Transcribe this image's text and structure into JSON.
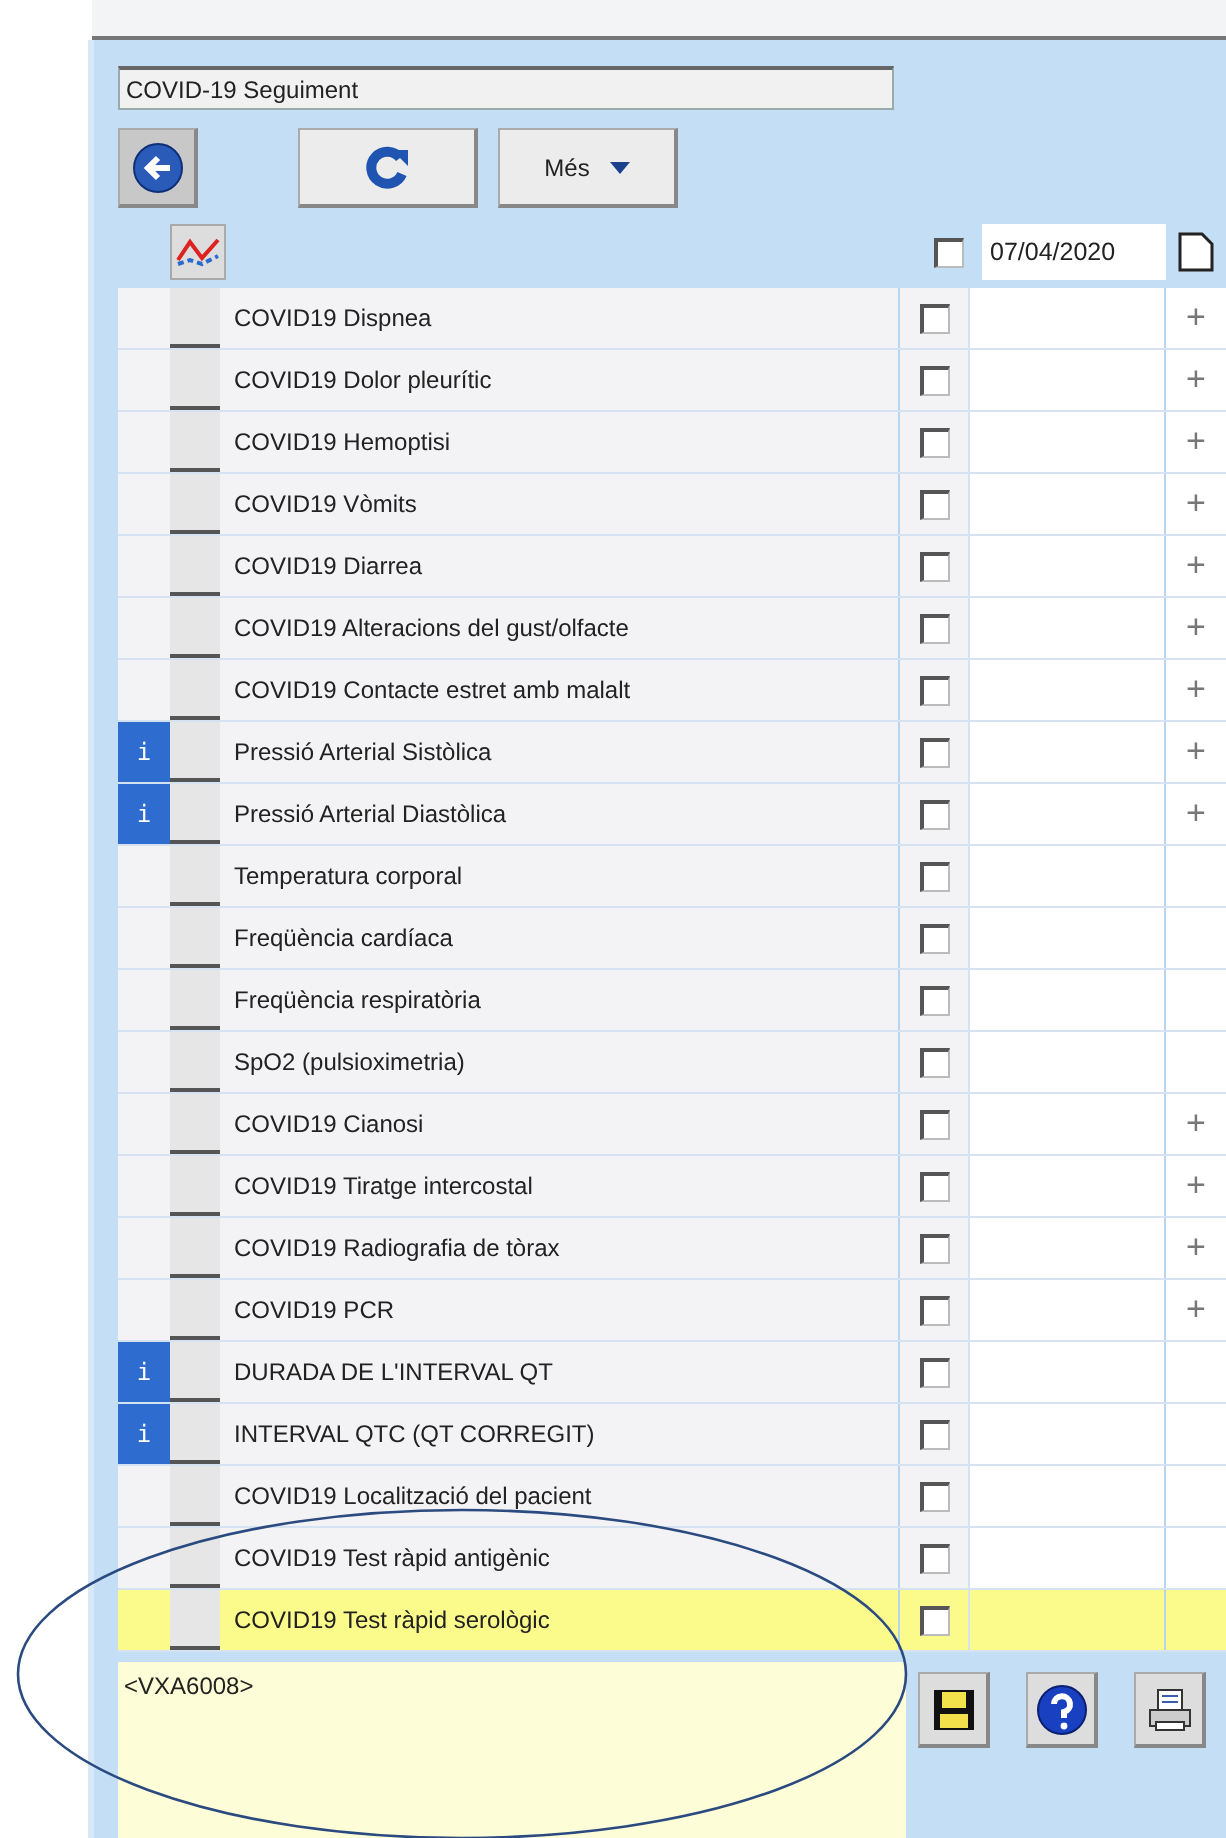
{
  "form_title": "COVID-19 Seguiment",
  "toolbar": {
    "more_button": "Més"
  },
  "header": {
    "select_all_checked": false,
    "date": "07/04/2020"
  },
  "rows": [
    {
      "label": "COVID19 Dispnea",
      "checked": false,
      "add": "+",
      "selected": false
    },
    {
      "label": "COVID19 Dolor pleurític",
      "checked": false,
      "add": "+",
      "selected": false
    },
    {
      "label": "COVID19 Hemoptisi",
      "checked": false,
      "add": "+",
      "selected": false
    },
    {
      "label": "COVID19 Vòmits",
      "checked": false,
      "add": "+",
      "selected": false
    },
    {
      "label": "COVID19 Diarrea",
      "checked": false,
      "add": "+",
      "selected": false
    },
    {
      "label": "COVID19 Alteracions del gust/olfacte",
      "checked": false,
      "add": "+",
      "selected": false
    },
    {
      "label": "COVID19 Contacte estret amb malalt",
      "checked": false,
      "add": "+",
      "selected": false
    },
    {
      "info": "i",
      "label": "Pressió Arterial Sistòlica",
      "checked": false,
      "add": "+",
      "selected": false
    },
    {
      "info": "i",
      "label": "Pressió Arterial Diastòlica",
      "checked": false,
      "add": "+",
      "selected": false
    },
    {
      "label": "Temperatura corporal",
      "checked": false,
      "selected": false
    },
    {
      "label": "Freqüència cardíaca",
      "checked": false,
      "selected": false
    },
    {
      "label": "Freqüència respiratòria",
      "checked": false,
      "selected": false
    },
    {
      "label": "SpO2 (pulsioximetria)",
      "checked": false,
      "selected": false
    },
    {
      "label": "COVID19 Cianosi",
      "checked": false,
      "add": "+",
      "selected": false
    },
    {
      "label": "COVID19 Tiratge intercostal",
      "checked": false,
      "add": "+",
      "selected": false
    },
    {
      "label": "COVID19 Radiografia de tòrax",
      "checked": false,
      "add": "+",
      "selected": false
    },
    {
      "label": "COVID19 PCR",
      "checked": false,
      "add": "+",
      "selected": false
    },
    {
      "info": "i",
      "label": "DURADA DE L'INTERVAL QT",
      "checked": false,
      "selected": false
    },
    {
      "info": "i",
      "label": "INTERVAL QTC (QT CORREGIT)",
      "checked": false,
      "selected": false
    },
    {
      "label": "COVID19 Localització del pacient",
      "checked": false,
      "selected": false
    },
    {
      "label": "COVID19 Test ràpid antigènic",
      "checked": false,
      "selected": false
    },
    {
      "label": "COVID19 Test ràpid serològic",
      "checked": false,
      "selected": true
    }
  ],
  "message": "<VXA6008>"
}
